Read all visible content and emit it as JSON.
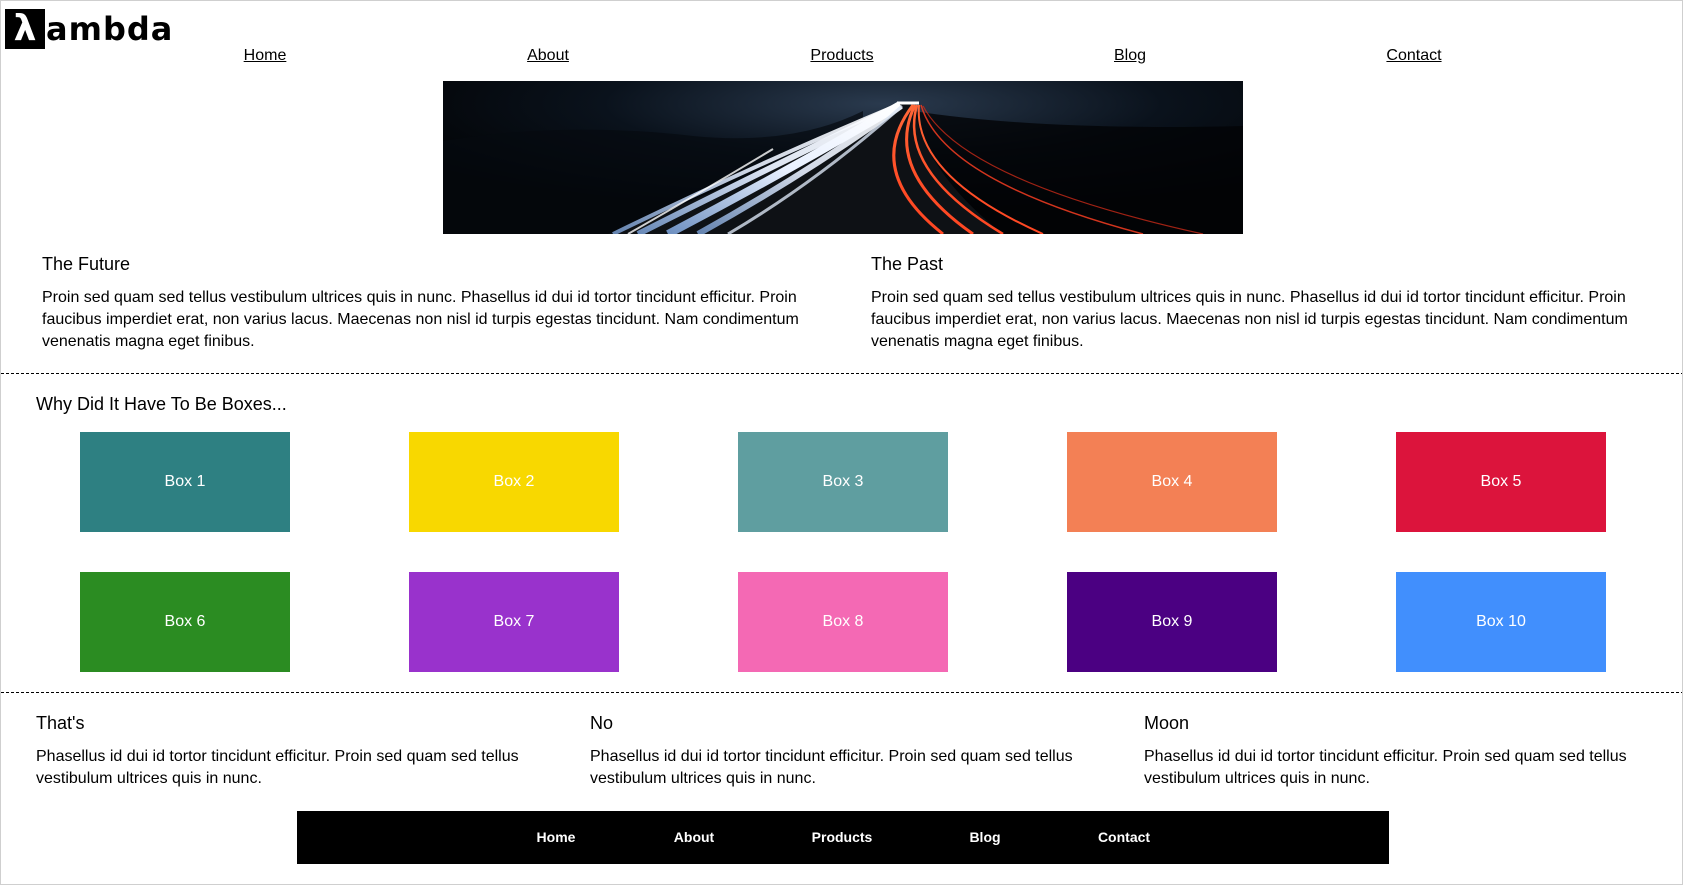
{
  "brand": {
    "logo_symbol": "λ",
    "logo_text": "ambda"
  },
  "nav": {
    "items": [
      "Home",
      "About",
      "Products",
      "Blog",
      "Contact"
    ]
  },
  "hero": {
    "alt": "Long exposure photo of a highway at night with light trails"
  },
  "sections": {
    "future": {
      "title": "The Future",
      "body": "Proin sed quam sed tellus vestibulum ultrices quis in nunc. Phasellus id dui id tortor tincidunt efficitur. Proin faucibus imperdiet erat, non varius lacus. Maecenas non nisl id turpis egestas tincidunt. Nam condimentum venenatis magna eget finibus."
    },
    "past": {
      "title": "The Past",
      "body": "Proin sed quam sed tellus vestibulum ultrices quis in nunc. Phasellus id dui id tortor tincidunt efficitur. Proin faucibus imperdiet erat, non varius lacus. Maecenas non nisl id turpis egestas tincidunt. Nam condimentum venenatis magna eget finibus."
    }
  },
  "boxes": {
    "title": "Why Did It Have To Be Boxes...",
    "items": [
      {
        "label": "Box 1",
        "color": "#2e8082"
      },
      {
        "label": "Box 2",
        "color": "#f8d800"
      },
      {
        "label": "Box 3",
        "color": "#5f9ea0"
      },
      {
        "label": "Box 4",
        "color": "#f38055"
      },
      {
        "label": "Box 5",
        "color": "#dc143c"
      },
      {
        "label": "Box 6",
        "color": "#2b8c22"
      },
      {
        "label": "Box 7",
        "color": "#9932cc"
      },
      {
        "label": "Box 8",
        "color": "#f469b4"
      },
      {
        "label": "Box 9",
        "color": "#4b0082"
      },
      {
        "label": "Box 10",
        "color": "#418ffd"
      }
    ]
  },
  "bottom": {
    "cols": [
      {
        "title": "That's",
        "body": "Phasellus id dui id tortor tincidunt efficitur. Proin sed quam sed tellus vestibulum ultrices quis in nunc."
      },
      {
        "title": "No",
        "body": "Phasellus id dui id tortor tincidunt efficitur. Proin sed quam sed tellus vestibulum ultrices quis in nunc."
      },
      {
        "title": "Moon",
        "body": "Phasellus id dui id tortor tincidunt efficitur. Proin sed quam sed tellus vestibulum ultrices quis in nunc."
      }
    ]
  },
  "footer": {
    "items": [
      "Home",
      "About",
      "Products",
      "Blog",
      "Contact"
    ]
  }
}
